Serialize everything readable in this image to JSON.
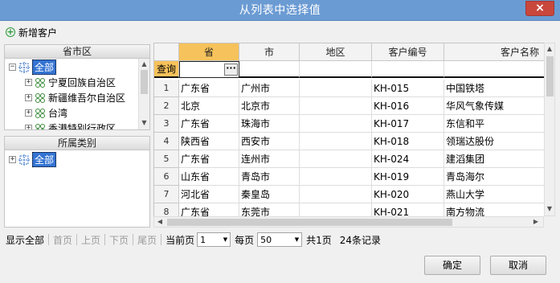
{
  "window": {
    "title": "从列表中选择值",
    "close_symbol": "×"
  },
  "toolbar": {
    "add_label": "新增客户"
  },
  "region_panel": {
    "title": "省市区",
    "items": [
      {
        "label": "全部",
        "level": 0,
        "selected": true
      },
      {
        "label": "宁夏回族自治区",
        "level": 1
      },
      {
        "label": "新疆维吾尔自治区",
        "level": 1
      },
      {
        "label": "台湾",
        "level": 1
      },
      {
        "label": "香港特别行政区",
        "level": 1
      }
    ]
  },
  "category_panel": {
    "title": "所属类别",
    "items": [
      {
        "label": "全部",
        "selected": true
      }
    ]
  },
  "grid": {
    "columns": [
      "省",
      "市",
      "地区",
      "客户编号",
      "客户名称"
    ],
    "query_label": "查询",
    "ellipsis": "···",
    "rows": [
      {
        "n": "1",
        "cells": [
          "广东省",
          "广州市",
          "",
          "KH-015",
          "中国铁塔"
        ]
      },
      {
        "n": "2",
        "cells": [
          "北京",
          "北京市",
          "",
          "KH-016",
          "华风气象传媒"
        ]
      },
      {
        "n": "3",
        "cells": [
          "广东省",
          "珠海市",
          "",
          "KH-017",
          "东信和平"
        ]
      },
      {
        "n": "4",
        "cells": [
          "陕西省",
          "西安市",
          "",
          "KH-018",
          "领瑞达股份"
        ]
      },
      {
        "n": "5",
        "cells": [
          "广东省",
          "连州市",
          "",
          "KH-024",
          "建滔集团"
        ]
      },
      {
        "n": "6",
        "cells": [
          "山东省",
          "青岛市",
          "",
          "KH-019",
          "青岛海尔"
        ]
      },
      {
        "n": "7",
        "cells": [
          "河北省",
          "秦皇岛",
          "",
          "KH-020",
          "燕山大学"
        ]
      },
      {
        "n": "8",
        "cells": [
          "广东省",
          "东莞市",
          "",
          "KH-021",
          "南方物流"
        ]
      }
    ]
  },
  "pager": {
    "show_all": "显示全部",
    "first": "首页",
    "prev": "上页",
    "next": "下页",
    "last": "尾页",
    "current_label": "当前页",
    "current_value": "1",
    "per_page_label": "每页",
    "per_page_value": "50",
    "total_pages": "共1页",
    "total_records": "24条记录"
  },
  "buttons": {
    "ok": "确定",
    "cancel": "取消"
  },
  "colors": {
    "titlebar": "#6b9bd3",
    "active_header": "#f6c25b",
    "selection": "#3574d3"
  }
}
